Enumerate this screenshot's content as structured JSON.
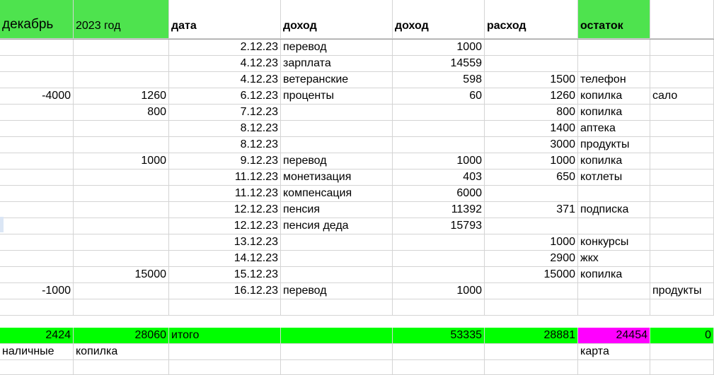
{
  "header": {
    "month": "декабрь",
    "year": "2023 год",
    "date": "дата",
    "income_source": "доход",
    "income": "доход",
    "expense": "расход",
    "balance": "остаток",
    "extra": ""
  },
  "rows": [
    {
      "a": "",
      "b": "",
      "date": "2.12.23",
      "source": "перевод",
      "income": "1000",
      "expense": "",
      "note": "",
      "extra": ""
    },
    {
      "a": "",
      "b": "",
      "date": "4.12.23",
      "source": "зарплата",
      "income": "14559",
      "expense": "",
      "note": "",
      "extra": ""
    },
    {
      "a": "",
      "b": "",
      "date": "4.12.23",
      "source": "ветеранские",
      "income": "598",
      "expense": "1500",
      "note": "телефон",
      "extra": ""
    },
    {
      "a": "-4000",
      "b": "1260",
      "date": "6.12.23",
      "source": "проценты",
      "income": "60",
      "expense": "1260",
      "note": "копилка",
      "extra": "сало"
    },
    {
      "a": "",
      "b": "800",
      "date": "7.12.23",
      "source": "",
      "income": "",
      "expense": "800",
      "note": "копилка",
      "extra": ""
    },
    {
      "a": "",
      "b": "",
      "date": "8.12.23",
      "source": "",
      "income": "",
      "expense": "1400",
      "note": "аптека",
      "extra": ""
    },
    {
      "a": "",
      "b": "",
      "date": "8.12.23",
      "source": "",
      "income": "",
      "expense": "3000",
      "note": "продукты",
      "extra": ""
    },
    {
      "a": "",
      "b": "1000",
      "date": "9.12.23",
      "source": "перевод",
      "income": "1000",
      "expense": "1000",
      "note": "копилка",
      "extra": ""
    },
    {
      "a": "",
      "b": "",
      "date": "11.12.23",
      "source": "монетизация",
      "income": "403",
      "expense": "650",
      "note": "котлеты",
      "extra": ""
    },
    {
      "a": "",
      "b": "",
      "date": "11.12.23",
      "source": "компенсация",
      "income": "6000",
      "expense": "",
      "note": "",
      "extra": ""
    },
    {
      "a": "",
      "b": "",
      "date": "12.12.23",
      "source": "пенсия",
      "income": "11392",
      "expense": "371",
      "note": "подписка",
      "extra": ""
    },
    {
      "a": "",
      "b": "",
      "date": "12.12.23",
      "source": "пенсия деда",
      "income": "15793",
      "expense": "",
      "note": "",
      "extra": ""
    },
    {
      "a": "",
      "b": "",
      "date": "13.12.23",
      "source": "",
      "income": "",
      "expense": "1000",
      "note": "конкурсы",
      "extra": ""
    },
    {
      "a": "",
      "b": "",
      "date": "14.12.23",
      "source": "",
      "income": "",
      "expense": "2900",
      "note": "жкх",
      "extra": ""
    },
    {
      "a": "",
      "b": "15000",
      "date": "15.12.23",
      "source": "",
      "income": "",
      "expense": "15000",
      "note": "копилка",
      "extra": ""
    },
    {
      "a": "-1000",
      "b": "",
      "date": "16.12.23",
      "source": "перевод",
      "income": "1000",
      "expense": "",
      "note": "",
      "extra": "продукты"
    },
    {
      "a": "",
      "b": "",
      "date": "",
      "source": "",
      "income": "",
      "expense": "",
      "note": "",
      "extra": ""
    }
  ],
  "totals": {
    "cash": "2424",
    "savings": "28060",
    "label": "итого",
    "source": "",
    "income": "53335",
    "expense": "28881",
    "balance": "24454",
    "extra": "0"
  },
  "footer": {
    "cash_label": "наличные",
    "savings_label": "копилка",
    "card_label": "карта"
  },
  "colors": {
    "header_green": "#4ee34e",
    "total_green": "#00ff00",
    "balance_magenta": "#ff00ff"
  }
}
